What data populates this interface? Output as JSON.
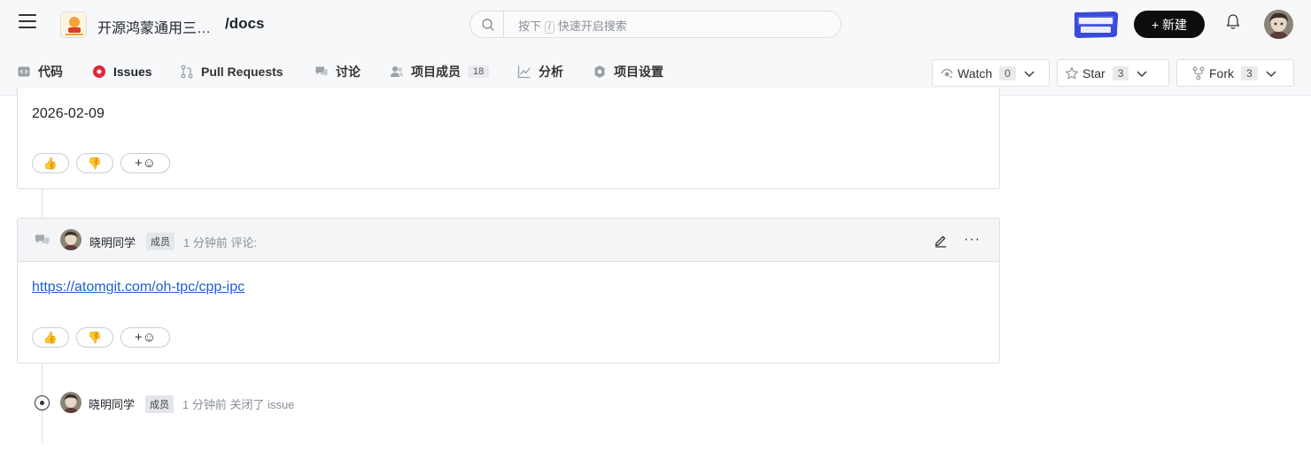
{
  "header": {
    "project_name": "开源鸿蒙通用三…",
    "project_path": "/docs",
    "search_placeholder_before": "按下",
    "search_key": "/",
    "search_placeholder_after": "快速开启搜索",
    "new_button": "+ 新建"
  },
  "tabs": [
    {
      "label": "代码"
    },
    {
      "label": "Issues"
    },
    {
      "label": "Pull Requests"
    },
    {
      "label": "讨论"
    },
    {
      "label": "项目成员",
      "count": "18"
    },
    {
      "label": "分析"
    },
    {
      "label": "项目设置"
    }
  ],
  "repo_actions": {
    "watch": {
      "label": "Watch",
      "count": "0"
    },
    "star": {
      "label": "Star",
      "count": "3"
    },
    "fork": {
      "label": "Fork",
      "count": "3"
    }
  },
  "comments": [
    {
      "body": "2026-02-09",
      "reactions": {
        "like": "👍",
        "dislike": "👎",
        "add": "+☺"
      }
    },
    {
      "author": "晓明同学",
      "role": "成员",
      "meta": "1 分钟前 评论:",
      "link": "https://atomgit.com/oh-tpc/cpp-ipc",
      "reactions": {
        "like": "👍",
        "dislike": "👎",
        "add": "+☺"
      }
    }
  ],
  "event": {
    "author": "晓明同学",
    "role": "成员",
    "meta": "1 分钟前 关闭了 issue"
  },
  "colors": {
    "accent": "#1f2328",
    "issues_icon": "#e5243b",
    "link": "#1f5fcf"
  }
}
